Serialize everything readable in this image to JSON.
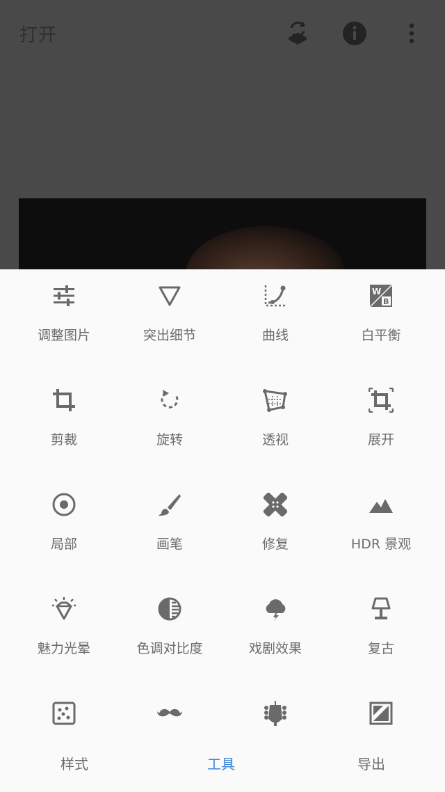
{
  "header": {
    "title": "打开",
    "icons": [
      "layers-rotate-icon",
      "info-icon",
      "more-vert-icon"
    ]
  },
  "tools": [
    {
      "label": "调整图片",
      "icon": "tune-sliders-icon"
    },
    {
      "label": "突出细节",
      "icon": "triangle-down-icon"
    },
    {
      "label": "曲线",
      "icon": "curves-icon"
    },
    {
      "label": "白平衡",
      "icon": "white-balance-icon"
    },
    {
      "label": "剪裁",
      "icon": "crop-icon"
    },
    {
      "label": "旋转",
      "icon": "rotate-icon"
    },
    {
      "label": "透视",
      "icon": "perspective-icon"
    },
    {
      "label": "展开",
      "icon": "expand-icon"
    },
    {
      "label": "局部",
      "icon": "selective-target-icon"
    },
    {
      "label": "画笔",
      "icon": "brush-icon"
    },
    {
      "label": "修复",
      "icon": "healing-bandage-icon"
    },
    {
      "label": "HDR 景观",
      "icon": "mountains-icon"
    },
    {
      "label": "魅力光晕",
      "icon": "diamond-glow-icon"
    },
    {
      "label": "色调对比度",
      "icon": "tonal-contrast-icon"
    },
    {
      "label": "戏剧效果",
      "icon": "storm-cloud-icon"
    },
    {
      "label": "复古",
      "icon": "lamp-icon"
    },
    {
      "label": "",
      "icon": "dice-icon"
    },
    {
      "label": "",
      "icon": "mustache-icon"
    },
    {
      "label": "",
      "icon": "guitar-head-icon"
    },
    {
      "label": "",
      "icon": "frames-icon"
    }
  ],
  "tabs": [
    {
      "label": "样式",
      "active": false
    },
    {
      "label": "工具",
      "active": true
    },
    {
      "label": "导出",
      "active": false
    }
  ],
  "colors": {
    "accent": "#3d84d6",
    "icon": "#6a6a6a",
    "overlay": "#494949"
  }
}
